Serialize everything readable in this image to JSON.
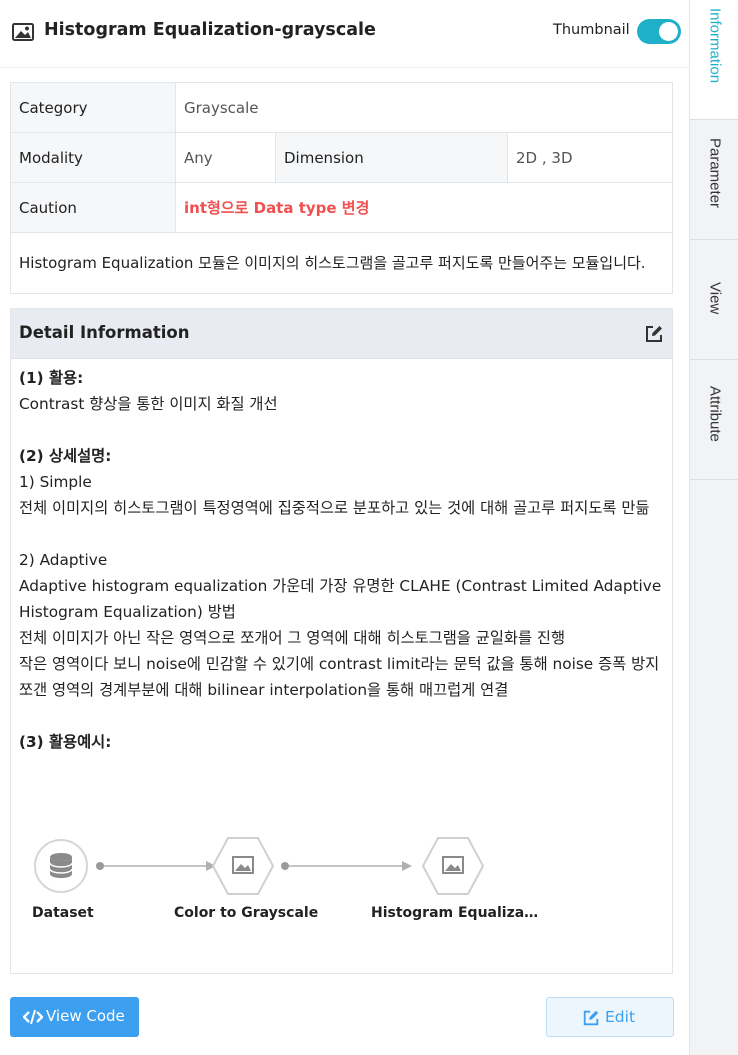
{
  "header": {
    "title": "Histogram Equalization-grayscale",
    "thumbnail_label": "Thumbnail",
    "thumbnail_on": true,
    "title_icon": "image-icon"
  },
  "info": {
    "category_label": "Category",
    "category_value": "Grayscale",
    "modality_label": "Modality",
    "modality_value": "Any",
    "dimension_label": "Dimension",
    "dimension_value": "2D , 3D",
    "caution_label": "Caution",
    "caution_value": "int형으로 Data type 변경",
    "description": "Histogram Equalization 모듈은 이미지의 히스토그램을 골고루 퍼지도록 만들어주는 모듈입니다."
  },
  "detail": {
    "title": "Detail Information",
    "s1_title": "(1) 활용:",
    "s1_line1": "Contrast 향상을 통한 이미지 화질 개선",
    "s2_title": "(2) 상세설명:",
    "s2_simple": "1) Simple",
    "s2_simple_desc": "전체 이미지의 히스토그램이 특정영역에 집중적으로 분포하고 있는 것에 대해 골고루 퍼지도록 만듦",
    "s2_adaptive": "2) Adaptive",
    "s2_adaptive_l1": "Adaptive histogram equalization 가운데 가장 유명한 CLAHE (Contrast Limited Adaptive Histogram Equalization) 방법",
    "s2_adaptive_l2": "전체 이미지가 아닌 작은 영역으로 쪼개어 그 영역에 대해 히스토그램을 균일화를 진행",
    "s2_adaptive_l3": "작은 영역이다 보니 noise에 민감할 수 있기에 contrast limit라는 문턱 값을 통해 noise 증폭 방지",
    "s2_adaptive_l4": "쪼갠 영역의 경계부분에 대해 bilinear interpolation을 통해 매끄럽게 연결",
    "s3_title": "(3) 활용예시:",
    "flow": {
      "node1": "Dataset",
      "node2": "Color to Grayscale",
      "node3": "Histogram Equaliza…"
    }
  },
  "buttons": {
    "view_code": "View Code",
    "edit": "Edit"
  },
  "tabs": [
    {
      "label": "Information",
      "active": true
    },
    {
      "label": "Parameter",
      "active": false
    },
    {
      "label": "View",
      "active": false
    },
    {
      "label": "Attribute",
      "active": false
    }
  ],
  "colors": {
    "accent": "#1fb0c9",
    "button_blue": "#3d9ff0",
    "caution_red": "#f0504f"
  }
}
